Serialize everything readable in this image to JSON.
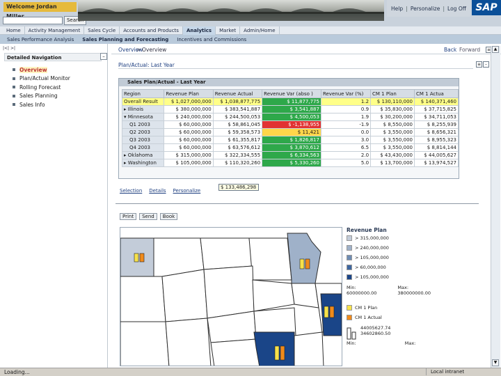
{
  "header": {
    "welcome": "Welcome Jordan Miller",
    "search_label": "Search",
    "links": [
      "Help",
      "Personalize",
      "Log Off"
    ],
    "logo": "SAP"
  },
  "menu": {
    "items": [
      "Home",
      "Activity Management",
      "Sales Cycle",
      "Accounts and Products",
      "Analytics",
      "Market",
      "Admin/Home"
    ],
    "active": "Analytics"
  },
  "submenu": {
    "items": [
      "Sales Performance Analysis",
      "Sales Planning and Forecasting",
      "Incentives and Commissions"
    ],
    "active": "Sales Planning and Forecasting"
  },
  "leftnav": {
    "title": "Detailed Navigation",
    "items": [
      "Overview",
      "Plan/Actual Monitor",
      "Rolling Forecast",
      "Sales Planning",
      "Sales Info"
    ],
    "selected": "Overview"
  },
  "breadcrumb": {
    "first": "Overview",
    "second": "Overview",
    "back": "Back",
    "forward": "Forward"
  },
  "panel": {
    "title": "Plan/Actual: Last Year",
    "table_title": "Sales Plan/Actual - Last Year"
  },
  "table": {
    "headers": [
      "Region",
      "Revenue Plan",
      "Revenue Actual",
      "Revenue Var (abso )",
      "Revenue Var (%)",
      "CM 1 Plan",
      "CM 1 Actua"
    ],
    "rows": [
      {
        "name": "Overall Result",
        "cells": [
          "$ 1,027,000,000",
          "$ 1,038,877,775",
          "$ 11,877,775",
          "1.2",
          "$ 130,110,000",
          "$ 140,371,460"
        ]
      },
      {
        "name": "Illinois",
        "cells": [
          "$ 380,000,000",
          "$ 383,541,887",
          "$ 3,541,887",
          "0.9",
          "$ 35,830,000",
          "$ 37,715,825"
        ]
      },
      {
        "name": "Minnesota",
        "cells": [
          "$ 240,000,000",
          "$ 244,500,053",
          "$ 4,500,053",
          "1.9",
          "$ 30,200,000",
          "$ 34,711,053"
        ]
      },
      {
        "name": "Q1 2003",
        "cells": [
          "$ 60,000,000",
          "$ 58,861,045",
          "$ -1,138,955",
          "-1.9",
          "$ 8,550,000",
          "$ 8,255,939"
        ]
      },
      {
        "name": "Q2 2003",
        "cells": [
          "$ 60,000,000",
          "$ 59,358,573",
          "$ 11,421",
          "0.0",
          "$ 3,550,000",
          "$ 8,656,321"
        ]
      },
      {
        "name": "Q3 2003",
        "cells": [
          "$ 60,000,000",
          "$ 61,355,817",
          "$ 1,826,817",
          "3.0",
          "$ 3,550,000",
          "$ 8,955,323"
        ]
      },
      {
        "name": "Q4 2003",
        "cells": [
          "$ 60,000,000",
          "$ 63,576,612",
          "$ 3,870,612",
          "6.5",
          "$ 3,550,000",
          "$ 8,814,144"
        ]
      },
      {
        "name": "Oklahoma",
        "cells": [
          "$ 315,000,000",
          "$ 322,334,555",
          "$ 6,334,563",
          "2.0",
          "$ 43,430,000",
          "$ 44,005,627"
        ]
      },
      {
        "name": "Washington",
        "cells": [
          "$ 105,000,000",
          "$ 110,320,260",
          "$ 5,330,260",
          "5.0",
          "$ 13,700,000",
          "$ 13,974,527"
        ]
      }
    ]
  },
  "links": [
    "Selection",
    "Details",
    "Personalize"
  ],
  "tooltip": "$ 133,486,298",
  "map_tabs": [
    "Print",
    "Send",
    "Book"
  ],
  "legend": {
    "title": "Revenue Plan",
    "ranges": [
      "> 315,000,000",
      "> 240,000,000",
      "> 105,000,000",
      "> 60,000,000",
      "> 105,000,000"
    ],
    "min_label": "Min:",
    "max_label": "Max:",
    "min_value": "60000000.00",
    "max_value": "380000000.00",
    "series": [
      "CM 1 Plan",
      "CM 1 Actual"
    ],
    "small_values": [
      "44005627.74",
      "34602860.50"
    ],
    "bottom_min": "Min:",
    "bottom_max": "Max:"
  },
  "colors": {
    "legend": [
      "#c3ccd9",
      "#9fb1c9",
      "#6e8cb3",
      "#3d66a0",
      "#1a4588"
    ],
    "bar_plan": "#f7e14a",
    "bar_actual": "#f08a1b"
  },
  "status": {
    "left": "Loading...",
    "right": "Local intranet"
  }
}
